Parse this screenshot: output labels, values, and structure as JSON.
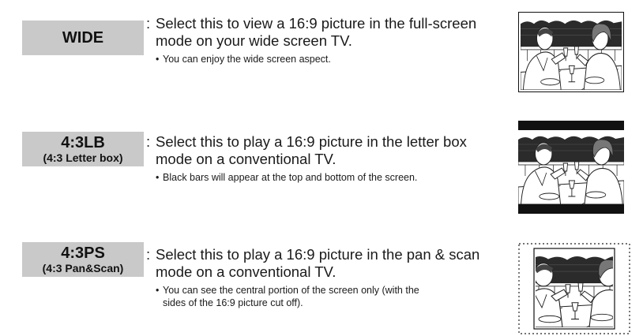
{
  "modes": [
    {
      "label": "WIDE",
      "sublabel": "",
      "text_line1": "Select this to view a 16:9 picture in the full-screen",
      "text_line2": "mode on your wide screen TV.",
      "bullet_line1": "You can enjoy the wide screen aspect.",
      "bullet_line2": "",
      "illustration": "wide-screen-illustration"
    },
    {
      "label": "4:3LB",
      "sublabel": "(4:3 Letter box)",
      "text_line1": "Select this to play a 16:9 picture in the letter box",
      "text_line2": "mode on a conventional TV.",
      "bullet_line1": "Black bars will appear at the top and bottom of the screen.",
      "bullet_line2": "",
      "illustration": "letter-box-illustration"
    },
    {
      "label": "4:3PS",
      "sublabel": "(4:3 Pan&Scan)",
      "text_line1": "Select this to play a 16:9 picture in the pan & scan",
      "text_line2": "mode on a conventional TV.",
      "bullet_line1": "You can see the central portion of the screen only (with the",
      "bullet_line2": "sides of the 16:9 picture cut off).",
      "illustration": "pan-scan-illustration"
    }
  ],
  "colon": ":",
  "bullet_mark": "•"
}
